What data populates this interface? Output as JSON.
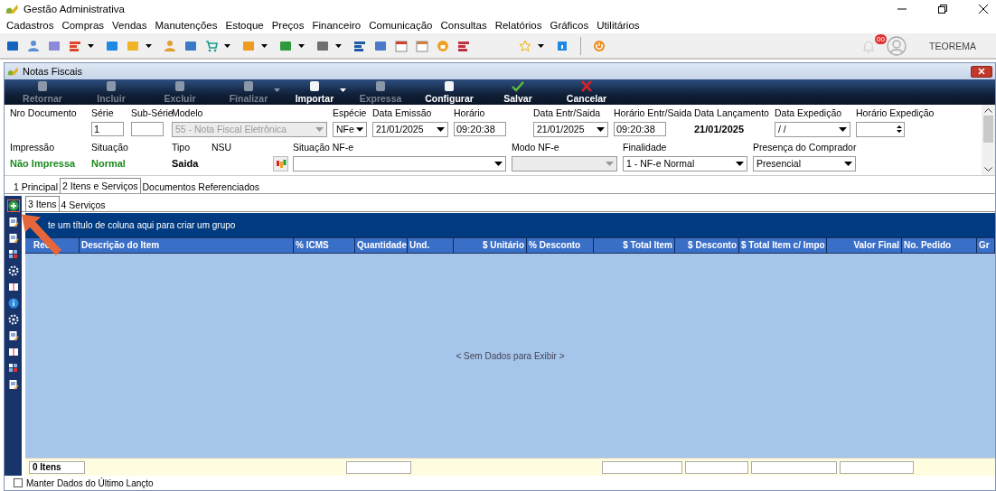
{
  "app": {
    "title": "Gestão Administrativa"
  },
  "menu": [
    "Cadastros",
    "Compras",
    "Vendas",
    "Manutenções",
    "Estoque",
    "Preços",
    "Financeiro",
    "Comunicação",
    "Consultas",
    "Relatórios",
    "Gráficos",
    "Utilitários"
  ],
  "toolbar": {
    "notification_count": "00",
    "user_name": "TEOREMA"
  },
  "window": {
    "title": "Notas Fiscais"
  },
  "actions": [
    {
      "label": "Retornar",
      "disabled": true,
      "has_menu": false
    },
    {
      "label": "Incluir",
      "disabled": true,
      "has_menu": false
    },
    {
      "label": "Excluir",
      "disabled": true,
      "has_menu": false
    },
    {
      "label": "Finalizar",
      "disabled": true,
      "has_menu": true
    },
    {
      "label": "Importar",
      "disabled": false,
      "has_menu": true
    },
    {
      "label": "Expressa",
      "disabled": true,
      "has_menu": false
    },
    {
      "label": "Configurar",
      "disabled": false,
      "has_menu": false
    },
    {
      "label": "Salvar",
      "disabled": false,
      "has_menu": false
    },
    {
      "label": "Cancelar",
      "disabled": false,
      "has_menu": false
    }
  ],
  "form_rows": [
    [
      {
        "label": "Nro Documento",
        "kind": "none"
      },
      {
        "label": "Série",
        "kind": "input",
        "value": "1"
      },
      {
        "label": "Sub-Série",
        "kind": "input"
      },
      {
        "label": "Modelo",
        "kind": "select",
        "value": "55 - Nota Fiscal Eletrônica",
        "disabled": true
      },
      {
        "label": "Espécie",
        "kind": "select",
        "value": "NFe",
        "disabled": false
      },
      {
        "label": "Data Emissão",
        "kind": "select",
        "value": "21/01/2025",
        "disabled": false
      },
      {
        "label": "Horário",
        "kind": "input",
        "value": "09:20:38"
      },
      {
        "label": "Data Entr/Saida",
        "kind": "select",
        "value": "21/01/2025",
        "disabled": false
      },
      {
        "label": "Horário Entr/Saida",
        "kind": "input",
        "value": "09:20:38"
      },
      {
        "label": "Data Lançamento",
        "kind": "text",
        "value": "21/01/2025",
        "color": "#000000"
      },
      {
        "label": "Data Expedição",
        "kind": "select",
        "value": " / /",
        "disabled": false
      },
      {
        "label": "Horário Expedição",
        "kind": "spin"
      }
    ],
    [
      {
        "label": "Impressão",
        "kind": "text",
        "value": "Não Impressa",
        "color": "#1e8a1e"
      },
      {
        "label": "Situação",
        "kind": "text",
        "value": "Normal",
        "color": "#1e8a1e"
      },
      {
        "label": "Tipo",
        "kind": "text",
        "value": "Saida",
        "color": "#000000"
      },
      {
        "label": "NSU",
        "kind": "button"
      },
      {
        "label": "Situação NF-e",
        "kind": "select",
        "disabled": false
      },
      {
        "label": "Modo NF-e",
        "kind": "select",
        "disabled": true
      },
      {
        "label": "Finalidade",
        "kind": "select",
        "value": "1 - NF-e Normal",
        "disabled": false
      },
      {
        "label": "Presença do Comprador",
        "kind": "select",
        "value": "Presencial",
        "disabled": false
      }
    ]
  ],
  "tabs": [
    {
      "label": "1 Principal",
      "selected": false
    },
    {
      "label": "2 Itens e Serviços",
      "selected": true
    },
    {
      "label": "Documentos Referenciados",
      "selected": false
    }
  ],
  "subtabs": [
    {
      "label": "3 Itens",
      "selected": true
    },
    {
      "label": "4 Serviços",
      "selected": false
    }
  ],
  "grid": {
    "group_hint": "te um título de coluna aqui para criar um grupo",
    "columns": [
      "Rec",
      "Descrição do Item",
      "% ICMS",
      "Quantidade",
      "Und.",
      "$ Unitário",
      "% Desconto",
      "$ Total Item",
      "$ Desconto",
      "$ Total Item c/ Impo",
      "Valor Final",
      "No. Pedido",
      "Gr"
    ],
    "empty_text": "< Sem Dados para Exibir >",
    "footer_count": "0 Itens"
  },
  "keep_data": {
    "label": "Manter Dados do Último Lançto",
    "checked": false
  }
}
